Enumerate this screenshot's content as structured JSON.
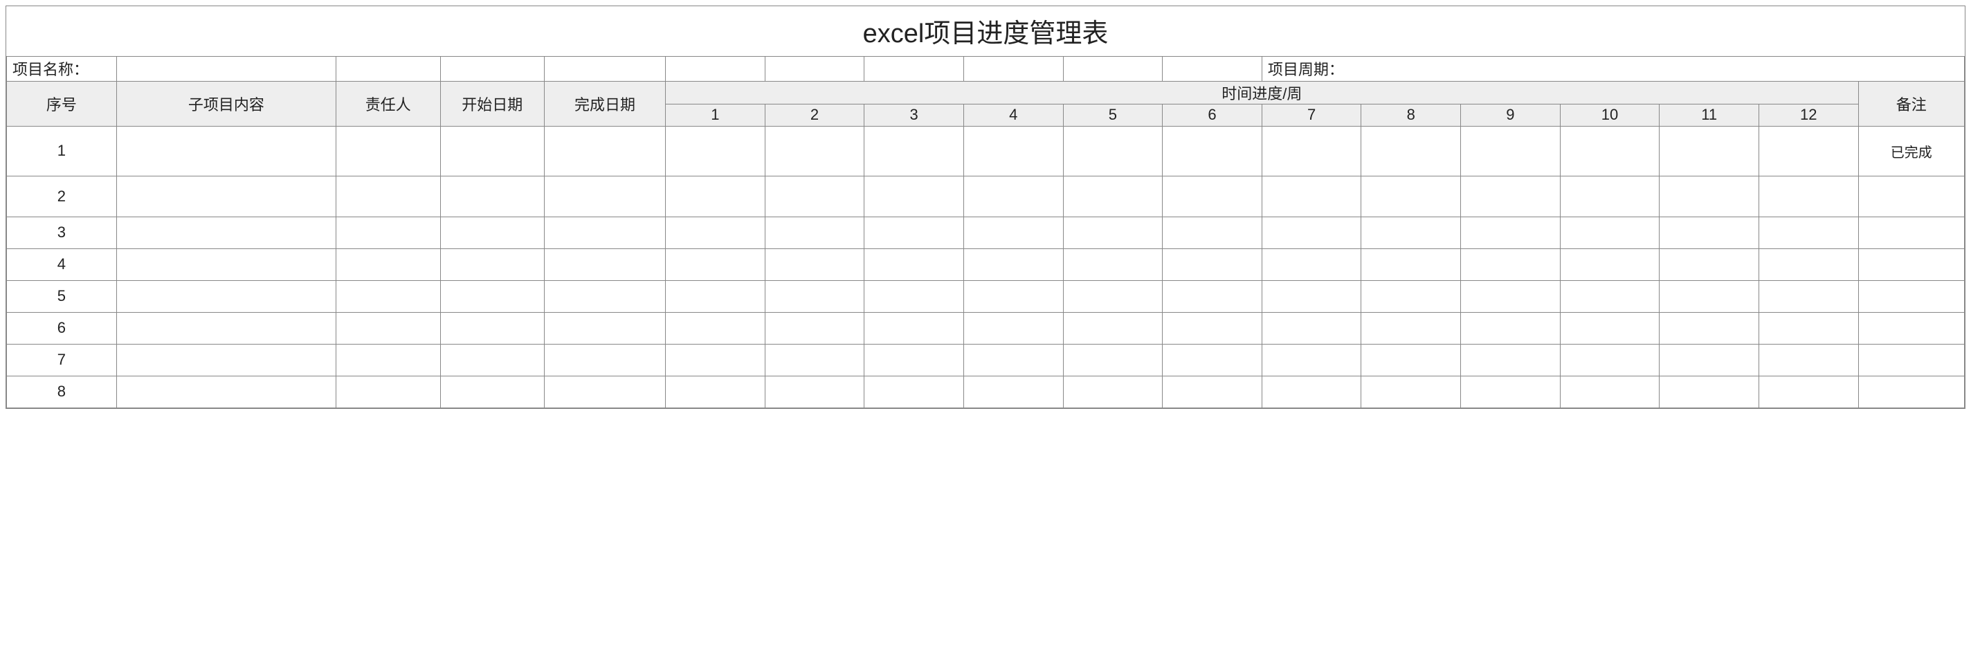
{
  "title": "excel项目进度管理表",
  "info": {
    "project_name_label": "项目名称：",
    "project_name_value": "",
    "project_cycle_label": "项目周期：",
    "project_cycle_value": ""
  },
  "headers": {
    "seq": "序号",
    "content": "子项目内容",
    "person": "责任人",
    "start": "开始日期",
    "end": "完成日期",
    "time_progress": "时间进度/周",
    "remark": "备注",
    "weeks": [
      "1",
      "2",
      "3",
      "4",
      "5",
      "6",
      "7",
      "8",
      "9",
      "10",
      "11",
      "12"
    ]
  },
  "rows": [
    {
      "seq": "1",
      "content": "",
      "person": "",
      "start": "",
      "end": "",
      "weeks": [
        "",
        "",
        "",
        "",
        "",
        "",
        "",
        "",
        "",
        "",
        "",
        ""
      ],
      "remark": "已完成"
    },
    {
      "seq": "2",
      "content": "",
      "person": "",
      "start": "",
      "end": "",
      "weeks": [
        "",
        "",
        "",
        "",
        "",
        "",
        "",
        "",
        "",
        "",
        "",
        ""
      ],
      "remark": ""
    },
    {
      "seq": "3",
      "content": "",
      "person": "",
      "start": "",
      "end": "",
      "weeks": [
        "",
        "",
        "",
        "",
        "",
        "",
        "",
        "",
        "",
        "",
        "",
        ""
      ],
      "remark": ""
    },
    {
      "seq": "4",
      "content": "",
      "person": "",
      "start": "",
      "end": "",
      "weeks": [
        "",
        "",
        "",
        "",
        "",
        "",
        "",
        "",
        "",
        "",
        "",
        ""
      ],
      "remark": ""
    },
    {
      "seq": "5",
      "content": "",
      "person": "",
      "start": "",
      "end": "",
      "weeks": [
        "",
        "",
        "",
        "",
        "",
        "",
        "",
        "",
        "",
        "",
        "",
        ""
      ],
      "remark": ""
    },
    {
      "seq": "6",
      "content": "",
      "person": "",
      "start": "",
      "end": "",
      "weeks": [
        "",
        "",
        "",
        "",
        "",
        "",
        "",
        "",
        "",
        "",
        "",
        ""
      ],
      "remark": ""
    },
    {
      "seq": "7",
      "content": "",
      "person": "",
      "start": "",
      "end": "",
      "weeks": [
        "",
        "",
        "",
        "",
        "",
        "",
        "",
        "",
        "",
        "",
        "",
        ""
      ],
      "remark": ""
    },
    {
      "seq": "8",
      "content": "",
      "person": "",
      "start": "",
      "end": "",
      "weeks": [
        "",
        "",
        "",
        "",
        "",
        "",
        "",
        "",
        "",
        "",
        "",
        ""
      ],
      "remark": ""
    }
  ]
}
